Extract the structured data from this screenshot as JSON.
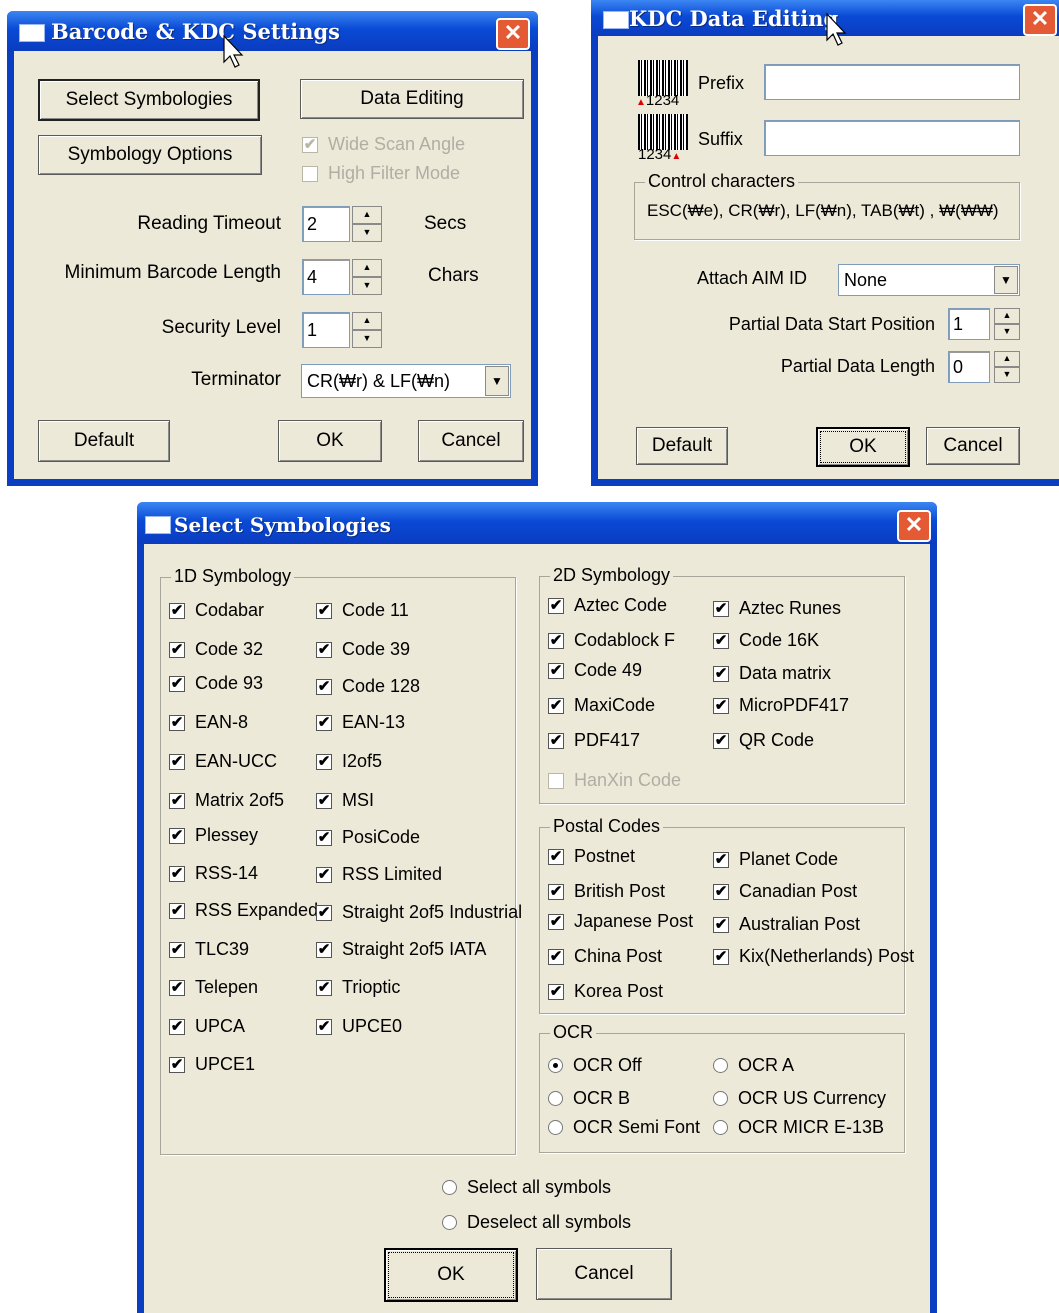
{
  "settings": {
    "title": "Barcode & KDC Settings",
    "close": "✕",
    "select_symbologies": "Select Symbologies",
    "data_editing": "Data Editing",
    "symbology_options": "Symbology Options",
    "wide_scan_angle": "Wide Scan Angle",
    "high_filter_mode": "High Filter Mode",
    "reading_timeout_label": "Reading Timeout",
    "reading_timeout_value": "2",
    "reading_timeout_unit": "Secs",
    "min_length_label": "Minimum Barcode Length",
    "min_length_value": "4",
    "min_length_unit": "Chars",
    "security_label": "Security Level",
    "security_value": "1",
    "terminator_label": "Terminator",
    "terminator_value": "CR(₩r) & LF(₩n)",
    "default": "Default",
    "ok": "OK",
    "cancel": "Cancel"
  },
  "kdc": {
    "title": "KDC Data Editing",
    "close": "✕",
    "prefix_label": "Prefix",
    "prefix_value": "",
    "prefix_code": "1234",
    "suffix_label": "Suffix",
    "suffix_value": "",
    "suffix_code": "1234",
    "control_title": "Control characters",
    "control_text": "ESC(₩e), CR(₩r), LF(₩n), TAB(₩t) , ₩(₩₩)",
    "aim_label": "Attach AIM ID",
    "aim_value": "None",
    "partial_start_label": "Partial Data Start Position",
    "partial_start_value": "1",
    "partial_length_label": "Partial Data Length",
    "partial_length_value": "0",
    "default": "Default",
    "ok": "OK",
    "cancel": "Cancel"
  },
  "symbologies": {
    "title": "Select Symbologies",
    "close": "✕",
    "group_1d": "1D Symbology",
    "items_1d_col1": [
      "Codabar",
      "Code 32",
      "Code 93",
      "EAN-8",
      "EAN-UCC",
      "Matrix 2of5",
      "Plessey",
      "RSS-14",
      "RSS Expanded",
      "TLC39",
      "Telepen",
      "UPCA",
      "UPCE1"
    ],
    "items_1d_col2": [
      "Code 11",
      "Code 39",
      "Code 128",
      "EAN-13",
      "I2of5",
      "MSI",
      "PosiCode",
      "RSS Limited",
      "Straight 2of5 Industrial",
      "Straight 2of5 IATA",
      "Trioptic",
      "UPCE0"
    ],
    "group_2d": "2D Symbology",
    "items_2d_col1": [
      "Aztec Code",
      "Codablock F",
      "Code 49",
      "MaxiCode",
      "PDF417"
    ],
    "items_2d_col2": [
      "Aztec Runes",
      "Code 16K",
      "Data matrix",
      "MicroPDF417",
      "QR Code"
    ],
    "hanxin": "HanXin Code",
    "group_postal": "Postal Codes",
    "postal_col1": [
      "Postnet",
      "British Post",
      "Japanese Post",
      "China Post",
      "Korea Post"
    ],
    "postal_col2": [
      "Planet Code",
      "Canadian Post",
      "Australian Post",
      "Kix(Netherlands) Post"
    ],
    "group_ocr": "OCR",
    "ocr_col1": [
      "OCR Off",
      "OCR B",
      "OCR Semi Font"
    ],
    "ocr_col2": [
      "OCR A",
      "OCR US Currency",
      "OCR MICR E-13B"
    ],
    "ocr_selected": "OCR Off",
    "select_all": "Select all symbols",
    "deselect_all": "Deselect all symbols",
    "ok": "OK",
    "cancel": "Cancel"
  },
  "icons": {
    "check": "✔",
    "close": "close-icon",
    "arrow_up": "▲",
    "arrow_down": "▼"
  }
}
